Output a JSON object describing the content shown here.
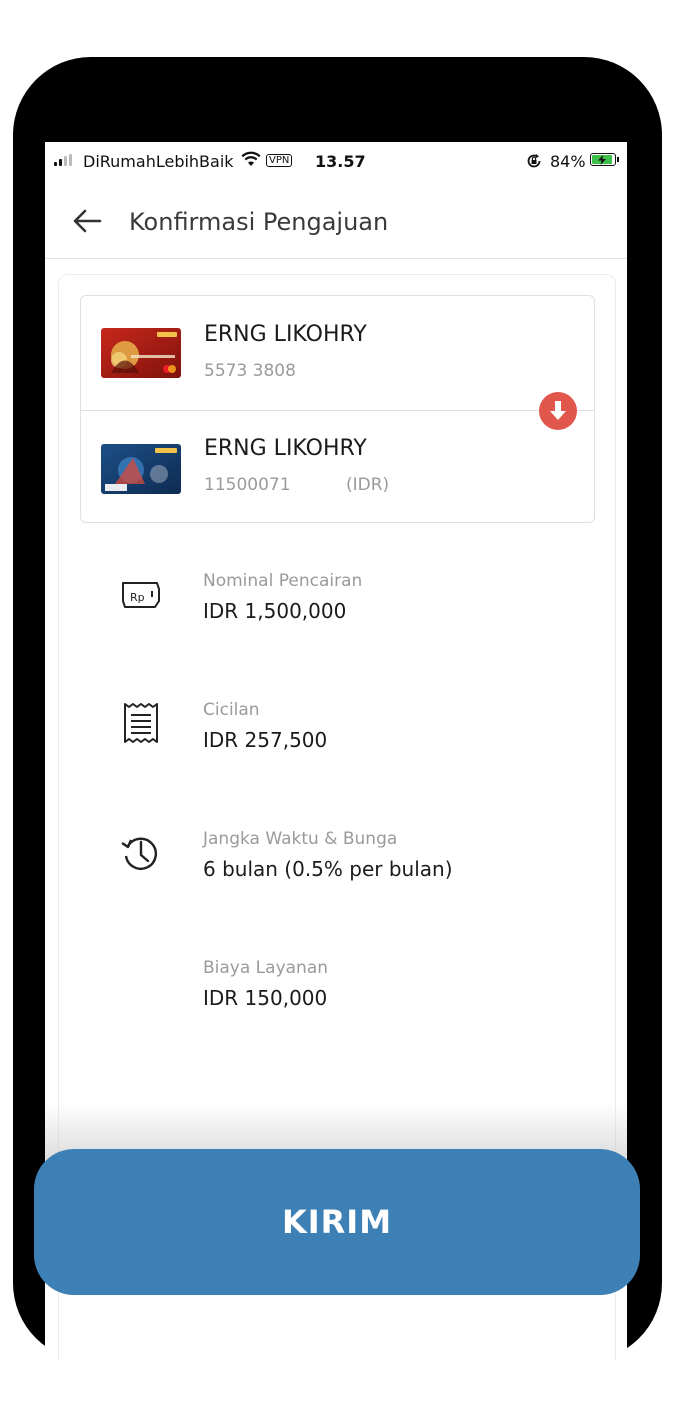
{
  "status_bar": {
    "carrier": "DiRumahLebihBaik",
    "vpn_label": "VPN",
    "time": "13.57",
    "battery": "84%",
    "icons": [
      "signal-icon",
      "wifi-icon",
      "vpn-icon",
      "rotation-lock-icon",
      "battery-charging-icon"
    ]
  },
  "header": {
    "title": "Konfirmasi Pengajuan",
    "back_icon": "arrow-left-icon"
  },
  "accounts": [
    {
      "name": "ERNG LIKOHRY",
      "number": "5573 3808",
      "currency": "",
      "card": "mandiri-red-credit-card"
    },
    {
      "name": "ERNG LIKOHRY",
      "number": "11500071",
      "currency": "(IDR)",
      "card": "mandiri-blue-visa-card"
    }
  ],
  "swap_icon": "arrow-down-circle-icon",
  "details": [
    {
      "label": "Nominal Pencairan",
      "value": "IDR 1,500,000",
      "icon": "money-rp-icon"
    },
    {
      "label": "Cicilan",
      "value": "IDR 257,500",
      "icon": "receipt-icon"
    },
    {
      "label": "Jangka Waktu & Bunga",
      "value": "6 bulan (0.5% per bulan)",
      "icon": "history-clock-icon"
    },
    {
      "label": "Biaya Layanan",
      "value": "IDR 150,000",
      "icon": ""
    }
  ],
  "submit_button": "KIRIM",
  "colors": {
    "button": "#3d80b6",
    "swap_button": "#e2574c",
    "label_gray": "#9a9a9a",
    "battery_green": "#3cc04a"
  }
}
